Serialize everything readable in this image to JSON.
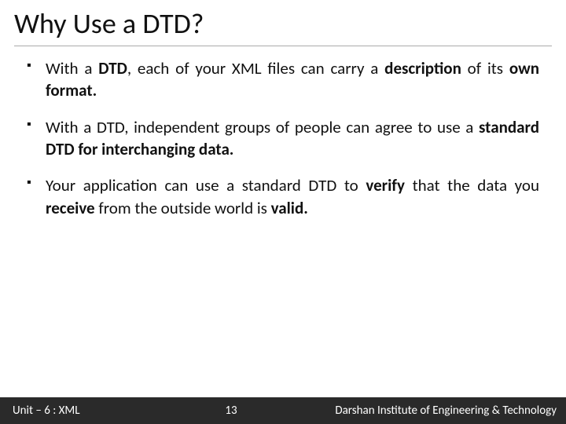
{
  "title": "Why Use a DTD?",
  "bullets": [
    {
      "html": "With a <b>DTD</b>, each of your XML files can carry a <b>description</b> of its <b>own format.</b>"
    },
    {
      "html": "With a DTD, independent groups of people can agree to use a <b>standard DTD for interchanging data.</b>"
    },
    {
      "html": "Your application can use a standard DTD to <b>verify</b> that the data you <b>receive</b> from the outside world is <b>valid.</b>"
    }
  ],
  "footer": {
    "left": "Unit – 6 : XML",
    "page": "13",
    "right": "Darshan Institute of Engineering & Technology"
  }
}
